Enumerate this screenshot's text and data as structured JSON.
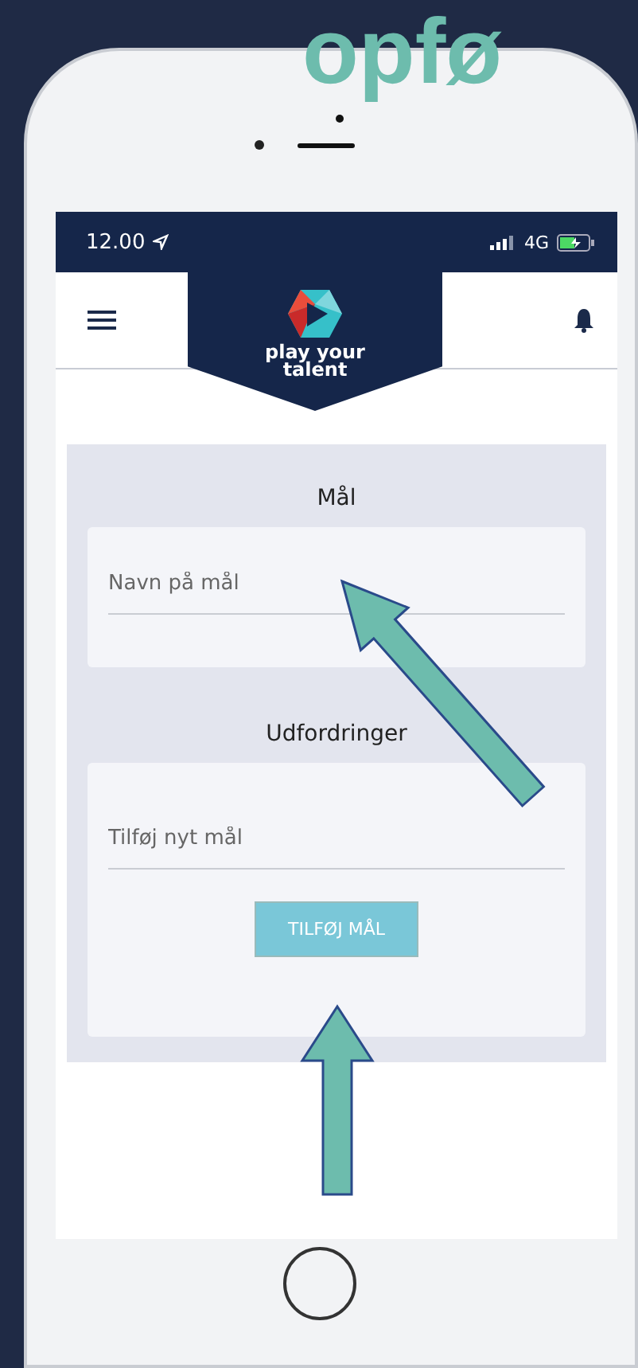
{
  "slide_title": "opfø",
  "status_bar": {
    "time": "12.00",
    "network": "4G"
  },
  "header": {
    "logo_text": "play your talent"
  },
  "sections": [
    {
      "title": "Mål",
      "field": {
        "placeholder": "Navn på mål"
      }
    },
    {
      "title": "Udfordringer",
      "field": {
        "placeholder": "Tilføj nyt mål"
      },
      "button": "TILFØJ MÅL"
    }
  ]
}
